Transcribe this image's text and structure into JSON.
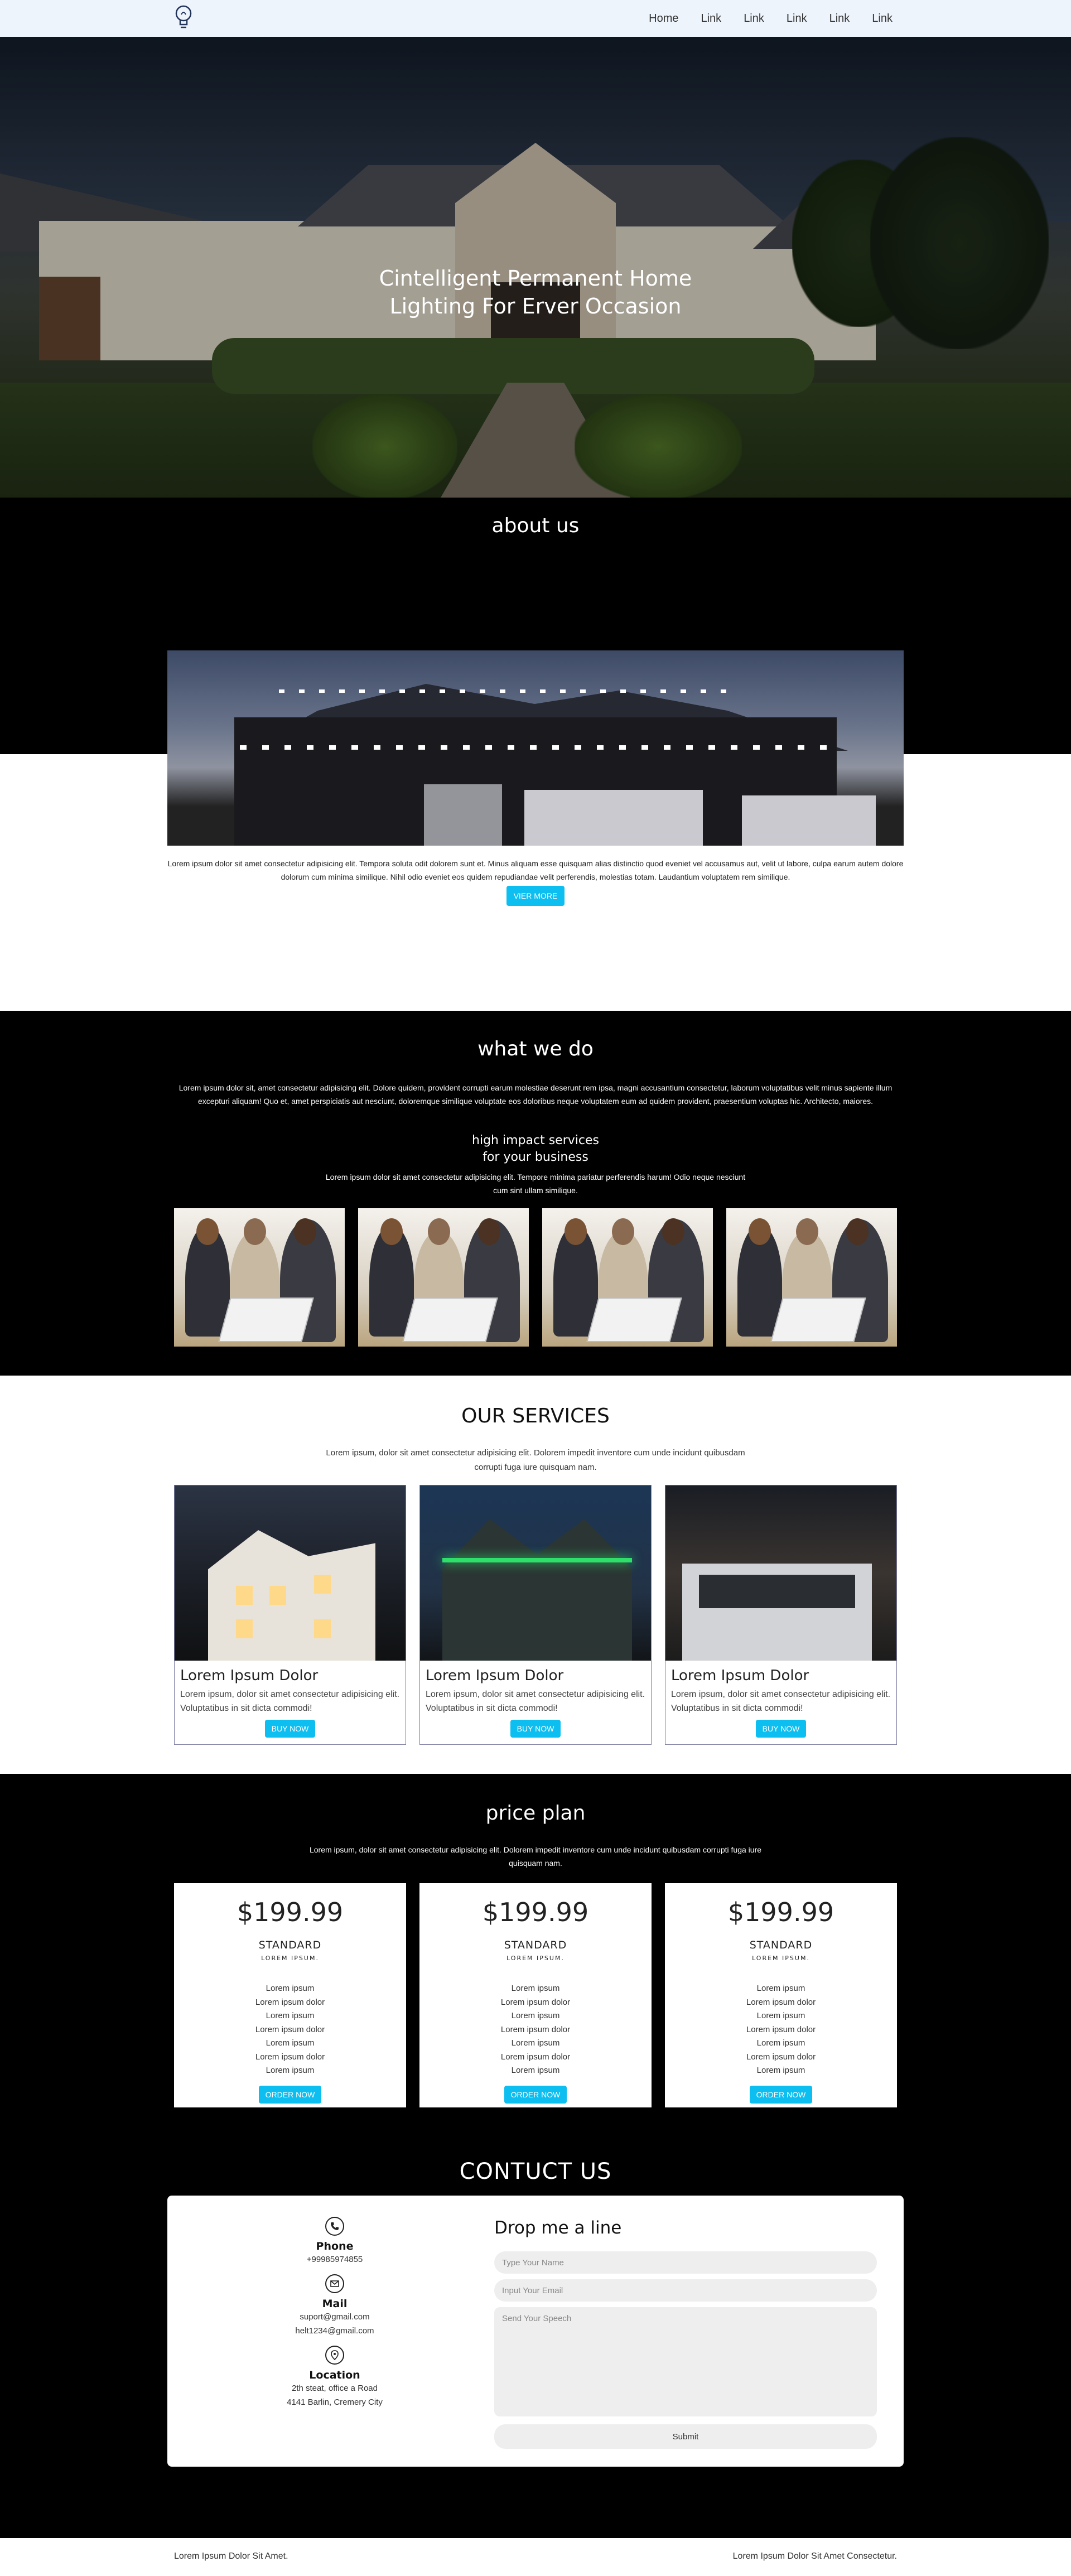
{
  "nav": {
    "logo_icon": "lightbulb-logo-icon",
    "links": [
      "Home",
      "Link",
      "Link",
      "Link",
      "Link",
      "Link"
    ]
  },
  "hero": {
    "title_line1": "Cintelligent Permanent Home",
    "title_line2": "Lighting For Erver Occasion"
  },
  "about": {
    "heading": "about us",
    "text": "Lorem ipsum dolor sit amet consectetur adipisicing elit. Tempora soluta odit dolorem sunt et. Minus aliquam esse quisquam alias distinctio quod eveniet vel accusamus aut, velit ut labore, culpa earum autem dolore dolorum cum minima similique. Nihil odio eveniet eos quidem repudiandae velit perferendis, molestias totam. Laudantium voluptatem rem similique.",
    "button": "VIER MORE"
  },
  "what_we_do": {
    "heading": "what we do",
    "text": "Lorem ipsum dolor sit, amet consectetur adipisicing elit. Dolore quidem, provident corrupti earum molestiae deserunt rem ipsa, magni accusantium consectetur, laborum voluptatibus velit minus sapiente illum excepturi aliquam! Quo et, amet perspiciatis aut nesciunt, doloremque similique voluptate eos doloribus neque voluptatem eum ad quidem provident, praesentium voluptas hic. Architecto, maiores.",
    "sub_heading_line1": "high impact services",
    "sub_heading_line2": "for your business",
    "sub_text": "Lorem ipsum dolor sit amet consectetur adipisicing elit. Tempore minima pariatur perferendis harum! Odio neque nesciunt cum sint ullam similique.",
    "tile_count": 4
  },
  "services": {
    "heading": "OUR SERVICES",
    "text": "Lorem ipsum, dolor sit amet consectetur adipisicing elit. Dolorem impedit inventore cum unde incidunt quibusdam corrupti fuga iure quisquam nam.",
    "cards": [
      {
        "title": "Lorem Ipsum Dolor",
        "text": "Lorem ipsum, dolor sit amet consectetur adipisicing elit. Voluptatibus in sit dicta commodi!",
        "button": "BUY NOW"
      },
      {
        "title": "Lorem Ipsum Dolor",
        "text": "Lorem ipsum, dolor sit amet consectetur adipisicing elit. Voluptatibus in sit dicta commodi!",
        "button": "BUY NOW"
      },
      {
        "title": "Lorem Ipsum Dolor",
        "text": "Lorem ipsum, dolor sit amet consectetur adipisicing elit. Voluptatibus in sit dicta commodi!",
        "button": "BUY NOW"
      }
    ]
  },
  "pricing": {
    "heading": "price plan",
    "text": "Lorem ipsum, dolor sit amet consectetur adipisicing elit. Dolorem impedit inventore cum unde incidunt quibusdam corrupti fuga iure quisquam nam.",
    "plans": [
      {
        "price": "$199.99",
        "tier": "STANDARD",
        "tier_sub": "LOREM IPSUM.",
        "features": [
          "Lorem ipsum",
          "Lorem ipsum dolor",
          "Lorem ipsum",
          "Lorem ipsum dolor",
          "Lorem ipsum",
          "Lorem ipsum dolor",
          "Lorem ipsum"
        ],
        "button": "ORDER NOW"
      },
      {
        "price": "$199.99",
        "tier": "STANDARD",
        "tier_sub": "LOREM IPSUM.",
        "features": [
          "Lorem ipsum",
          "Lorem ipsum dolor",
          "Lorem ipsum",
          "Lorem ipsum dolor",
          "Lorem ipsum",
          "Lorem ipsum dolor",
          "Lorem ipsum"
        ],
        "button": "ORDER NOW"
      },
      {
        "price": "$199.99",
        "tier": "STANDARD",
        "tier_sub": "LOREM IPSUM.",
        "features": [
          "Lorem ipsum",
          "Lorem ipsum dolor",
          "Lorem ipsum",
          "Lorem ipsum dolor",
          "Lorem ipsum",
          "Lorem ipsum dolor",
          "Lorem ipsum"
        ],
        "button": "ORDER NOW"
      }
    ]
  },
  "contact": {
    "heading": "CONTUCT US",
    "phone_label": "Phone",
    "phone_value": "+99985974855",
    "mail_label": "Mail",
    "mail_value1": "suport@gmail.com",
    "mail_value2": "helt1234@gmail.com",
    "location_label": "Location",
    "location_line1": "2th steat, office a Road",
    "location_line2": "4141 Barlin, Cremery City",
    "form_title": "Drop me a line",
    "name_placeholder": "Type Your Name",
    "email_placeholder": "Input Your Email",
    "speech_placeholder": "Send Your Speech",
    "submit": "Submit"
  },
  "footer": {
    "left": "Lorem Ipsum Dolor Sit Amet.",
    "right": "Lorem Ipsum Dolor Sit Amet Consectetur."
  },
  "colors": {
    "accent": "#0dbef0",
    "nav_bg": "#eef4fb",
    "dark_bg": "#000000"
  }
}
